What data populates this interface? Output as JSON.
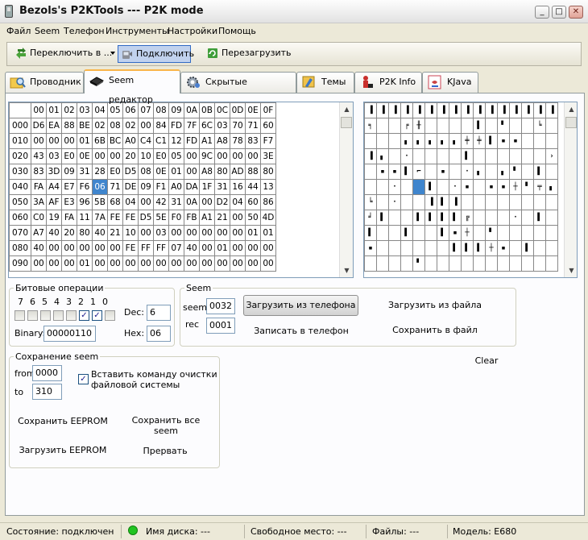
{
  "window": {
    "title": "Bezols's P2KTools --- P2K mode"
  },
  "menu": [
    "Файл",
    "Seem",
    "Телефон",
    "Инструменты",
    "Настройки",
    "Помощь"
  ],
  "toolbar": {
    "switch_label": "Переключить в ...",
    "connect_label": "Подключить",
    "reload_label": "Перезагрузить"
  },
  "tabs": [
    "Проводник",
    "Seem редактор",
    "Скрытые настройки",
    "Темы",
    "P2K Info",
    "KJava"
  ],
  "hex_editor": {
    "columns": [
      "00",
      "01",
      "02",
      "03",
      "04",
      "05",
      "06",
      "07",
      "08",
      "09",
      "0A",
      "0B",
      "0C",
      "0D",
      "0E",
      "0F"
    ],
    "rows": [
      {
        "addr": "000",
        "bytes": [
          "D6",
          "EA",
          "88",
          "BE",
          "02",
          "08",
          "02",
          "00",
          "84",
          "FD",
          "7F",
          "6C",
          "03",
          "70",
          "71",
          "60"
        ]
      },
      {
        "addr": "010",
        "bytes": [
          "00",
          "00",
          "00",
          "01",
          "6B",
          "BC",
          "A0",
          "C4",
          "C1",
          "12",
          "FD",
          "A1",
          "A8",
          "78",
          "83",
          "F7"
        ]
      },
      {
        "addr": "020",
        "bytes": [
          "43",
          "03",
          "E0",
          "0E",
          "00",
          "00",
          "20",
          "10",
          "E0",
          "05",
          "00",
          "9C",
          "00",
          "00",
          "00",
          "3E"
        ]
      },
      {
        "addr": "030",
        "bytes": [
          "83",
          "3D",
          "09",
          "31",
          "28",
          "E0",
          "D5",
          "08",
          "0E",
          "01",
          "00",
          "A8",
          "80",
          "AD",
          "88",
          "80"
        ]
      },
      {
        "addr": "040",
        "bytes": [
          "FA",
          "A4",
          "E7",
          "F6",
          "06",
          "71",
          "DE",
          "09",
          "F1",
          "A0",
          "DA",
          "1F",
          "31",
          "16",
          "44",
          "13"
        ]
      },
      {
        "addr": "050",
        "bytes": [
          "3A",
          "AF",
          "E3",
          "96",
          "5B",
          "68",
          "04",
          "00",
          "42",
          "31",
          "0A",
          "00",
          "D2",
          "04",
          "60",
          "86"
        ]
      },
      {
        "addr": "060",
        "bytes": [
          "C0",
          "19",
          "FA",
          "11",
          "7A",
          "FE",
          "FE",
          "D5",
          "5E",
          "F0",
          "FB",
          "A1",
          "21",
          "00",
          "50",
          "4D"
        ]
      },
      {
        "addr": "070",
        "bytes": [
          "A7",
          "40",
          "20",
          "80",
          "40",
          "21",
          "10",
          "00",
          "03",
          "00",
          "00",
          "00",
          "00",
          "00",
          "01",
          "01"
        ]
      },
      {
        "addr": "080",
        "bytes": [
          "40",
          "00",
          "00",
          "00",
          "00",
          "00",
          "FE",
          "FF",
          "FF",
          "07",
          "40",
          "00",
          "01",
          "00",
          "00",
          "00"
        ]
      },
      {
        "addr": "090",
        "bytes": [
          "00",
          "00",
          "00",
          "01",
          "00",
          "00",
          "00",
          "00",
          "00",
          "00",
          "00",
          "00",
          "00",
          "00",
          "00",
          "00"
        ]
      }
    ],
    "selected": {
      "row": 4,
      "col": 4
    }
  },
  "char_view": {
    "header": [
      "0",
      "1",
      "2",
      "3",
      "4",
      "5",
      "6",
      "7",
      "8",
      "9",
      "A",
      "B",
      "C",
      "D",
      "E",
      "F"
    ],
    "rows": [
      [
        "╕",
        "",
        "",
        "╒",
        "╫",
        "",
        "",
        "",
        "",
        "▌",
        "",
        "▘",
        "",
        "",
        "╘",
        ""
      ],
      [
        "",
        "",
        "",
        "▖",
        "▖",
        "▖",
        "▖",
        "▖",
        "╪",
        "╪",
        "▌",
        "▪",
        "▪",
        "",
        "",
        ""
      ],
      [
        "▐",
        "▖",
        "",
        "·",
        "",
        "",
        "",
        "",
        "▌",
        "",
        "",
        "",
        "",
        "",
        "",
        "›"
      ],
      [
        "",
        "▪",
        "▪",
        "▌",
        "⌐",
        "",
        "▪",
        "",
        "·",
        "▖",
        "",
        "▖",
        "▘",
        "",
        "▌",
        ""
      ],
      [
        "",
        "",
        "·",
        "",
        "",
        "▌",
        "",
        "·",
        "▪",
        "",
        "▪",
        "▪",
        "┼",
        "▘",
        "╤",
        "▖"
      ],
      [
        "╘",
        "",
        "·",
        "",
        "",
        "▐",
        "▌",
        "▐",
        "",
        "",
        "",
        "",
        "",
        "",
        "",
        ""
      ],
      [
        "╛",
        "▌",
        "",
        "",
        "▌",
        "▌",
        "▌",
        "▌",
        "╔",
        "",
        "",
        "",
        "·",
        "",
        "▌",
        ""
      ],
      [
        "▌",
        "",
        "",
        "▌",
        "",
        "",
        "▌",
        "▪",
        "┼",
        "",
        "▘",
        "",
        "",
        "",
        "",
        ""
      ],
      [
        "▪",
        "",
        "",
        "",
        "",
        "",
        "",
        "▌",
        "▌",
        "▌",
        "┼",
        "▪",
        "",
        "▌",
        "",
        ""
      ],
      [
        "",
        "",
        "",
        "",
        "▘",
        "",
        "",
        "",
        "",
        "",
        "",
        "",
        "",
        "",
        "",
        ""
      ]
    ]
  },
  "bit_ops": {
    "title": "Битовые операции",
    "bit_labels": [
      "7",
      "6",
      "5",
      "4",
      "3",
      "2",
      "1",
      "0"
    ],
    "checked": [
      false,
      false,
      false,
      false,
      false,
      true,
      true,
      false
    ],
    "dec_label": "Dec:",
    "dec_value": "6",
    "hex_label": "Hex:",
    "hex_value": "06",
    "binary_label": "Binary:",
    "binary_value": "00000110"
  },
  "seem": {
    "title": "Seem",
    "seem_label": "seem",
    "seem_value": "0032",
    "rec_label": "rec",
    "rec_value": "0001",
    "load_phone": "Загрузить из телефона",
    "load_file": "Загрузить из файла",
    "write_phone": "Записать в телефон",
    "save_file": "Сохранить в файл"
  },
  "clear_label": "Clear",
  "save_seem": {
    "title": "Сохранение seem",
    "from_label": "from",
    "from_value": "0000",
    "to_label": "to",
    "to_value": "310",
    "clear_fs_label_1": "Вставить команду очистки",
    "clear_fs_label_2": "файловой системы",
    "clear_fs_checked": true,
    "save_eeprom": "Сохранить EEPROM",
    "save_all": "Сохранить все seem",
    "load_eeprom": "Загрузить EEPROM",
    "abort": "Прервать"
  },
  "status": {
    "state": "Состояние: подключен",
    "disk": "Имя диска: ---",
    "free": "Свободное место: ---",
    "files": "Файлы: ---",
    "model": "Модель: E680",
    "led_color": "#21c421"
  }
}
